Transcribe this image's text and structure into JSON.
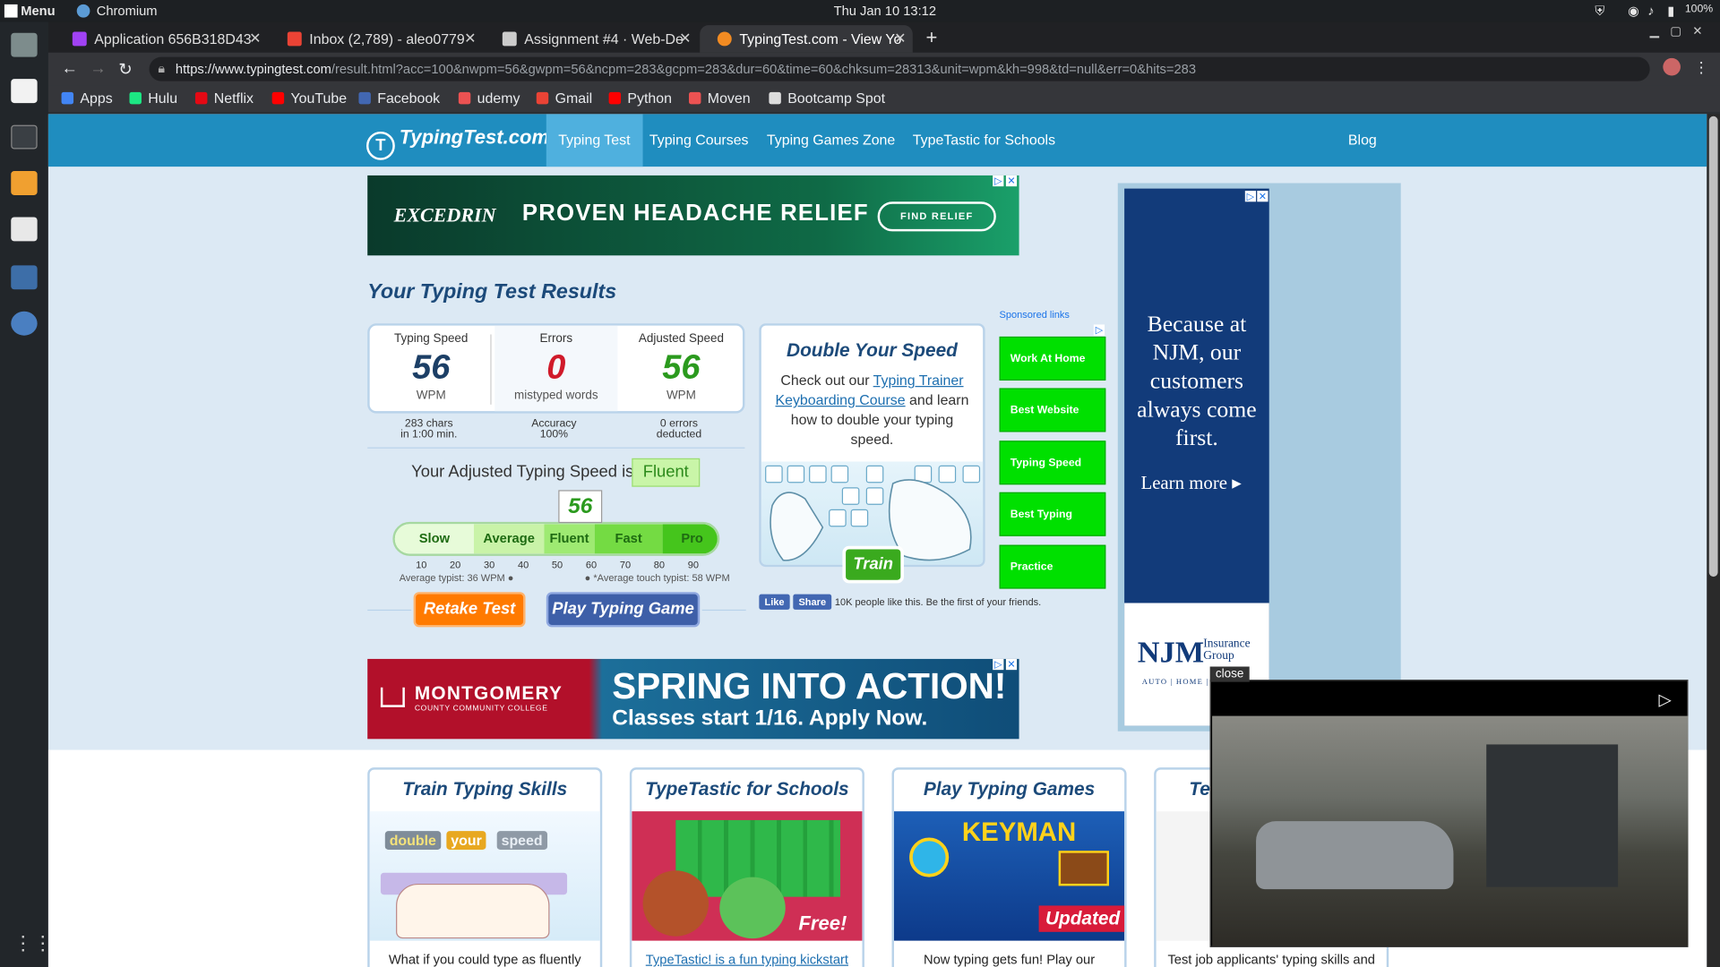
{
  "os": {
    "menu": "Menu",
    "app": "Chromium",
    "clock": "Thu Jan 10  13:12",
    "battery": "100%"
  },
  "tabs": [
    {
      "label": "Application 656B318D43",
      "color": "#a142f4"
    },
    {
      "label": "Inbox (2,789) - aleo0779",
      "color": "#ea4335"
    },
    {
      "label": "Assignment #4 · Web-De",
      "color": "#cccccc"
    },
    {
      "label": "TypingTest.com - View Yo",
      "color": "#f28b22"
    }
  ],
  "url": {
    "host": "https://www.typingtest.com",
    "rest": "/result.html?acc=100&nwpm=56&gwpm=56&ncpm=283&gcpm=283&dur=60&time=60&chksum=28313&unit=wpm&kh=998&td=null&err=0&hits=283"
  },
  "bookmarks": [
    {
      "label": "Apps",
      "color": "#4285f4"
    },
    {
      "label": "Hulu",
      "color": "#1ce783"
    },
    {
      "label": "Netflix",
      "color": "#e50914"
    },
    {
      "label": "YouTube",
      "color": "#ff0000"
    },
    {
      "label": "Facebook",
      "color": "#4267b2"
    },
    {
      "label": "udemy",
      "color": "#ec5252"
    },
    {
      "label": "Gmail",
      "color": "#ea4335"
    },
    {
      "label": "Python",
      "color": "#ff0000"
    },
    {
      "label": "Moven",
      "color": "#ec5252"
    },
    {
      "label": "Bootcamp Spot",
      "color": "#dddddd"
    }
  ],
  "site": {
    "logo": "TypingTest.com",
    "nav": [
      "Typing Test",
      "Typing Courses",
      "Typing Games Zone",
      "TypeTastic for Schools",
      "Blog"
    ]
  },
  "ad_top": {
    "brand": "EXCEDRIN",
    "tagline": "PROVEN HEADACHE RELIEF",
    "button": "FIND RELIEF"
  },
  "results": {
    "title": "Your Typing Test Results",
    "typing_speed": {
      "label": "Typing Speed",
      "value": "56",
      "unit": "WPM",
      "sub1": "283 chars",
      "sub2": "in 1:00 min."
    },
    "errors": {
      "label": "Errors",
      "value": "0",
      "unit": "mistyped words",
      "sub1": "Accuracy",
      "sub2": "100%"
    },
    "adjusted": {
      "label": "Adjusted Speed",
      "value": "56",
      "unit": "WPM",
      "sub1": "0 errors",
      "sub2": "deducted"
    },
    "adjusted_text": "Your Adjusted Typing Speed is",
    "level": "Fluent",
    "marker": "56",
    "scale": [
      "Slow",
      "Average",
      "Fluent",
      "Fast",
      "Pro"
    ],
    "ticks": [
      "10",
      "20",
      "30",
      "40",
      "50",
      "60",
      "70",
      "80",
      "90"
    ],
    "avg_typist": "Average typist: 36 WPM",
    "avg_touch": "*Average touch typist: 58 WPM",
    "retake": "Retake Test",
    "play": "Play Typing Game"
  },
  "promo": {
    "title": "Double Your Speed",
    "text1": "Check out our ",
    "link": "Typing Trainer Keyboarding Course",
    "text2": " and learn how to double your typing speed.",
    "train": "Train",
    "fb_like": "Like",
    "fb_share": "Share",
    "fb_text": "10K people like this. Be the first of your friends."
  },
  "sponsored": {
    "label": "Sponsored links",
    "links": [
      "Work At Home",
      "Best Website",
      "Typing Speed",
      "Best Typing",
      "Practice"
    ]
  },
  "njm_ad": {
    "text": "Because at NJM, our customers always come first.",
    "learn": "Learn more",
    "logo": "NJM",
    "logo2": "Insurance Group",
    "foot": "AUTO | HOME |"
  },
  "ad_mid": {
    "college": "MONTGOMERY",
    "college_sub": "COUNTY COMMUNITY COLLEGE",
    "line1": "SPRING INTO ACTION!",
    "line2": "Classes start 1/16. Apply Now."
  },
  "cards": [
    {
      "title": "Train Typing Skills",
      "caption": "What if you could type as fluently"
    },
    {
      "title": "TypeTastic for Schools",
      "caption": "TypeTastic! is a fun typing kickstart"
    },
    {
      "title": "Play Typing Games",
      "caption": "Now typing gets fun! Play our"
    },
    {
      "title": "Te",
      "caption": "Test job applicants' typing skills and"
    }
  ],
  "card_badges": {
    "free": "Free!",
    "updated": "Updated",
    "keyman": "KEYMAN",
    "words": [
      "double",
      "your",
      "speed"
    ]
  },
  "video": {
    "close": "close"
  }
}
